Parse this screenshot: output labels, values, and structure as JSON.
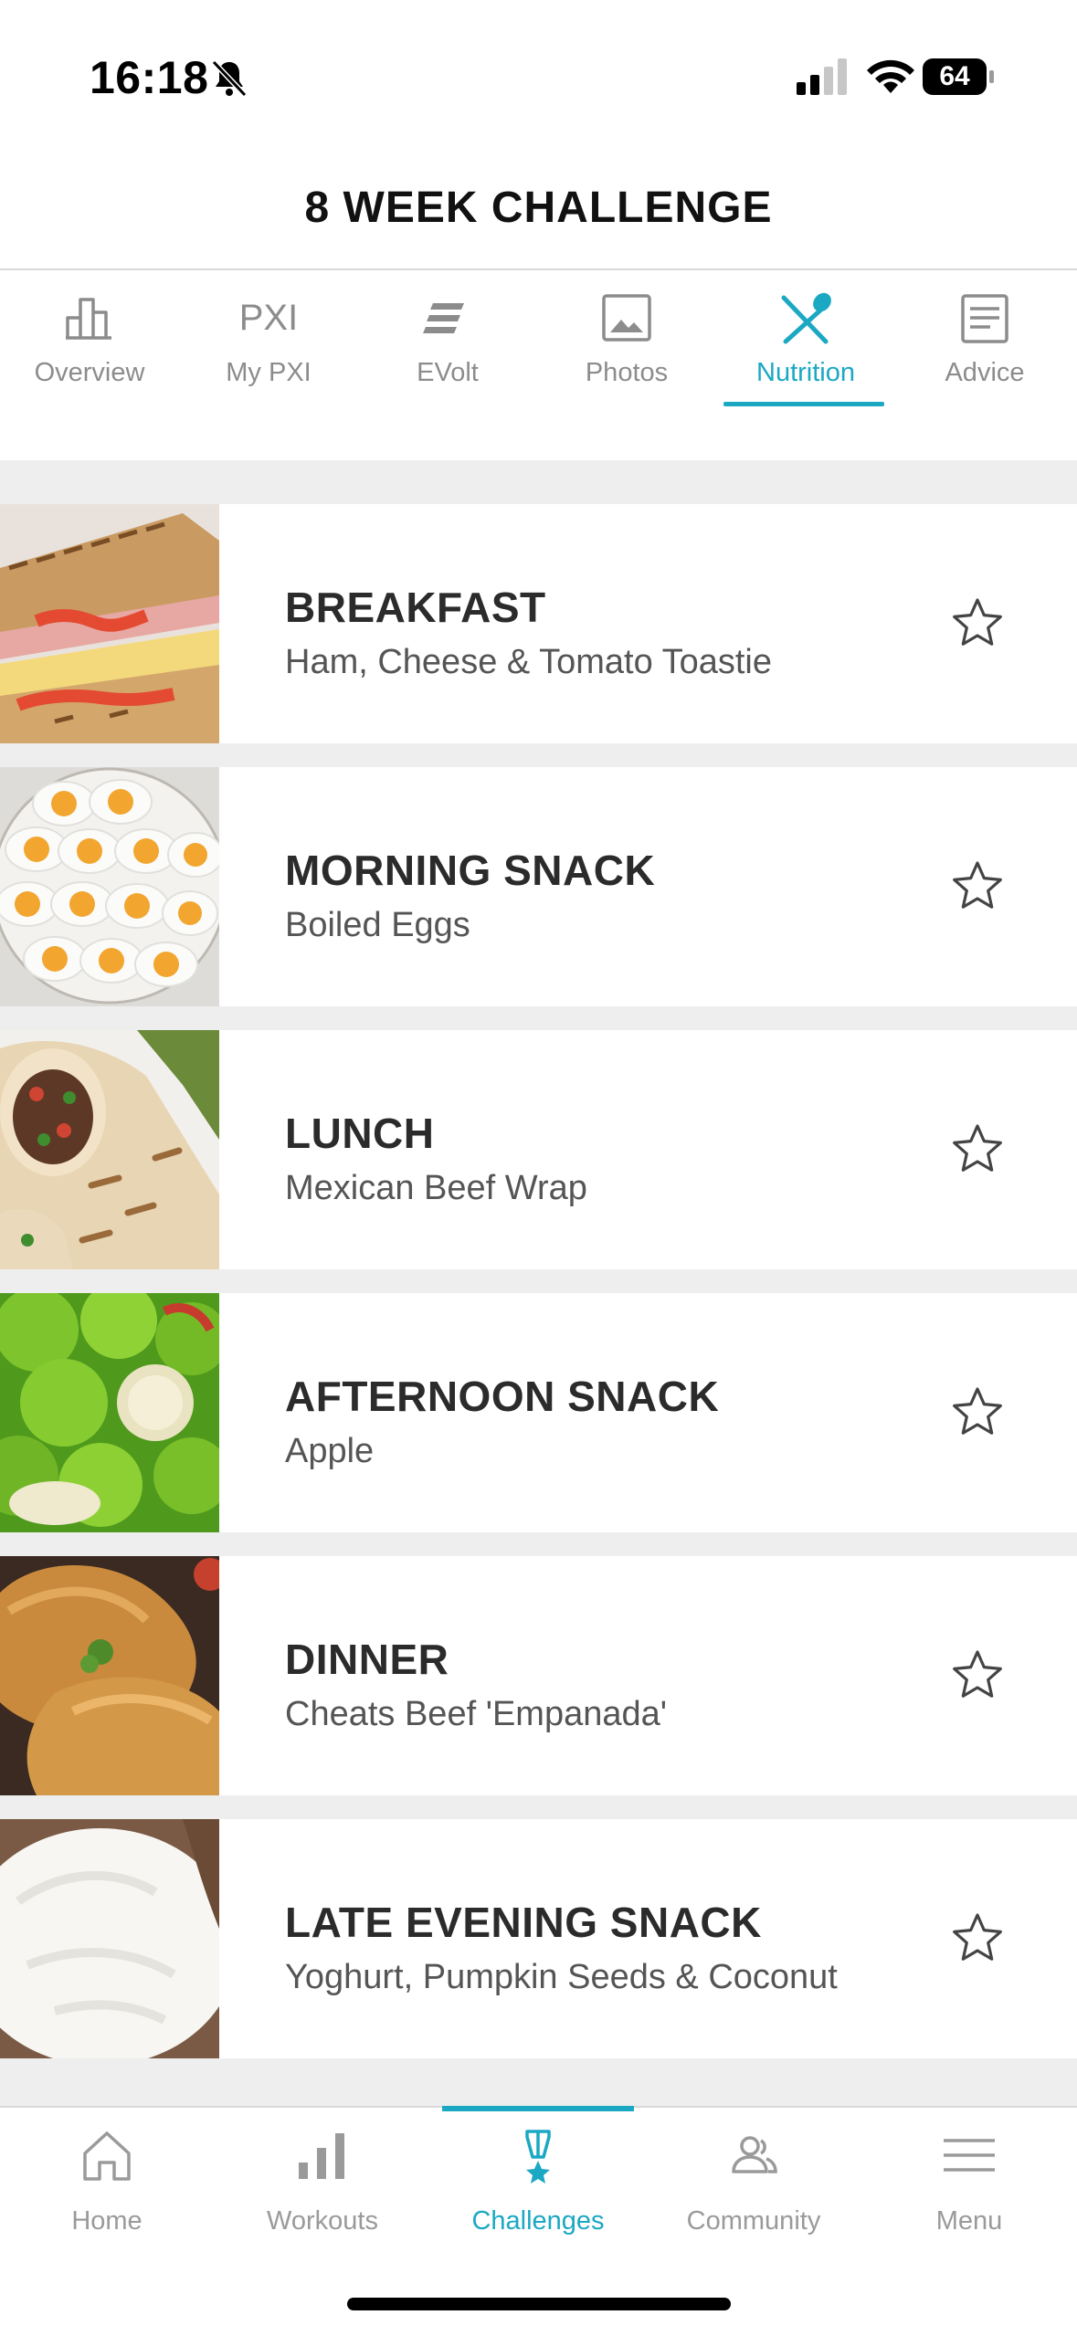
{
  "status_bar": {
    "time": "16:18",
    "battery": "64"
  },
  "header": {
    "title": "8 WEEK CHALLENGE"
  },
  "tabs": [
    {
      "label": "Overview",
      "icon": "bar-chart-icon"
    },
    {
      "label": "My PXI",
      "icon_text": "PXI"
    },
    {
      "label": "EVolt",
      "icon": "evolt-icon"
    },
    {
      "label": "Photos",
      "icon": "photo-icon"
    },
    {
      "label": "Nutrition",
      "icon": "fork-spoon-icon",
      "active": true
    },
    {
      "label": "Advice",
      "icon": "document-icon"
    }
  ],
  "meals": [
    {
      "meal": "BREAKFAST",
      "dish": "Ham, Cheese & Tomato Toastie",
      "image": "toastie-image"
    },
    {
      "meal": "MORNING SNACK",
      "dish": "Boiled Eggs",
      "image": "boiled-eggs-image"
    },
    {
      "meal": "LUNCH",
      "dish": "Mexican Beef Wrap",
      "image": "beef-wrap-image"
    },
    {
      "meal": "AFTERNOON SNACK",
      "dish": "Apple",
      "image": "apples-image"
    },
    {
      "meal": "DINNER",
      "dish": "Cheats Beef 'Empanada'",
      "image": "empanada-image"
    },
    {
      "meal": "LATE EVENING SNACK",
      "dish": "Yoghurt, Pumpkin Seeds & Coconut",
      "image": "yoghurt-image"
    }
  ],
  "bottom_nav": [
    {
      "label": "Home",
      "icon": "home-icon"
    },
    {
      "label": "Workouts",
      "icon": "workouts-bars-icon"
    },
    {
      "label": "Challenges",
      "icon": "medal-icon",
      "active": true
    },
    {
      "label": "Community",
      "icon": "community-icon"
    },
    {
      "label": "Menu",
      "icon": "hamburger-icon"
    }
  ],
  "colors": {
    "accent": "#1ba8c3",
    "inactive": "#8c8c8c",
    "divider": "#eeeeee"
  }
}
